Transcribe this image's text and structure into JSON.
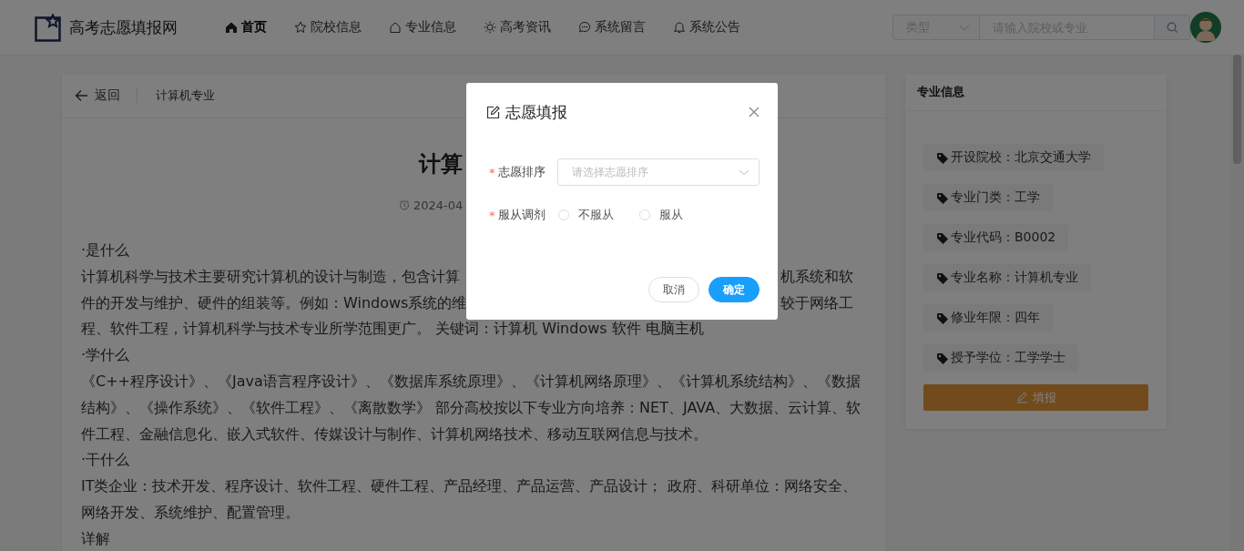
{
  "header": {
    "logo": "高考志愿填报网",
    "nav": [
      {
        "label": "首页",
        "selected": true
      },
      {
        "label": "院校信息",
        "selected": false
      },
      {
        "label": "专业信息",
        "selected": false
      },
      {
        "label": "高考资讯",
        "selected": false
      },
      {
        "label": "系统留言",
        "selected": false
      },
      {
        "label": "系统公告",
        "selected": false
      }
    ],
    "search": {
      "type_placeholder": "类型",
      "placeholder": "请输入院校或专业"
    }
  },
  "article": {
    "back": "返回",
    "breadcrumb": "计算机专业",
    "title": "计算",
    "date": "2024-04",
    "lines": [
      {
        "left": "·是什么"
      },
      {
        "left": "计算机科学与技术主要研究计算机的设计与制造，包含计算",
        "right": "机系统和软"
      },
      {
        "left": "件的开发与维护、硬件的组装等。例如：Windows系统的维",
        "right": "较于网络工"
      },
      {
        "left": "程、软件工程，计算机科学与技术专业所学范围更广。 关键词：计算机 Windows 软件 电脑主机"
      },
      {
        "left": "·学什么"
      },
      {
        "left": "《C++程序设计》、《Java语言程序设计》、《数据库系统原理》、《计算机网络原理》、《计算机系统结构》、《数据"
      },
      {
        "left": "结构》、《操作系统》、《软件工程》、《离散数学》 部分高校按以下专业方向培养：NET、JAVA、大数据、云计算、软"
      },
      {
        "left": "件工程、金融信息化、嵌入式软件、传媒设计与制作、计算机网络技术、移动互联网信息与技术。"
      },
      {
        "left": "·干什么"
      },
      {
        "left": "IT类企业：技术开发、程序设计、软件工程、硬件工程、产品经理、产品运营、产品设计； 政府、科研单位：网络安全、"
      },
      {
        "left": "网络开发、系统维护、配置管理。"
      },
      {
        "left": "详解"
      }
    ]
  },
  "info_card": {
    "title": "专业信息",
    "tags": [
      "开设院校：北京交通大学",
      "专业门类：工学",
      "专业代码：B0002",
      "专业名称：计算机专业",
      "修业年限：四年",
      "授予学位：工学学士"
    ],
    "button": "填报"
  },
  "dialog": {
    "title": "志愿填报",
    "fields": [
      {
        "kind": "select",
        "mark": "*",
        "label": "志愿排序",
        "placeholder": "请选择志愿排序"
      },
      {
        "kind": "radio",
        "mark": "*",
        "label": "服从调剂",
        "options": [
          {
            "label": "不服从",
            "selected": false
          },
          {
            "label": "服从",
            "selected": false
          }
        ]
      }
    ],
    "buttons": [
      {
        "kind": "default",
        "label": "取消"
      },
      {
        "kind": "primary",
        "label": "确定"
      }
    ]
  }
}
